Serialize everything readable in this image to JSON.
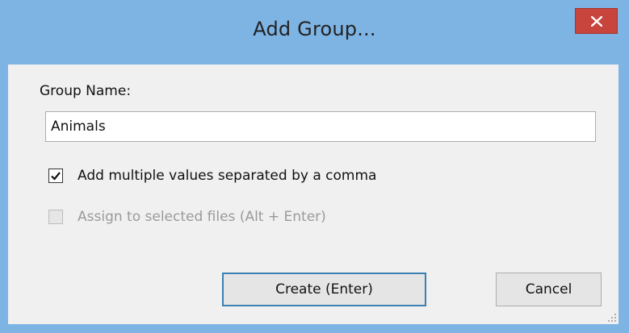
{
  "dialog": {
    "title": "Add Group...",
    "close_icon": "close-icon"
  },
  "form": {
    "group_name_label": "Group Name:",
    "group_name_value": "Animals",
    "multiple_values": {
      "label": "Add multiple values separated by a comma",
      "checked": true
    },
    "assign_selected": {
      "label": "Assign to selected files (Alt + Enter)",
      "checked": false,
      "disabled": true
    }
  },
  "buttons": {
    "create_label": "Create (Enter)",
    "cancel_label": "Cancel"
  },
  "colors": {
    "titlebar": "#7eb4e4",
    "close": "#c7453c",
    "client": "#f0f0f0",
    "default_button_border": "#3c7fb1"
  }
}
